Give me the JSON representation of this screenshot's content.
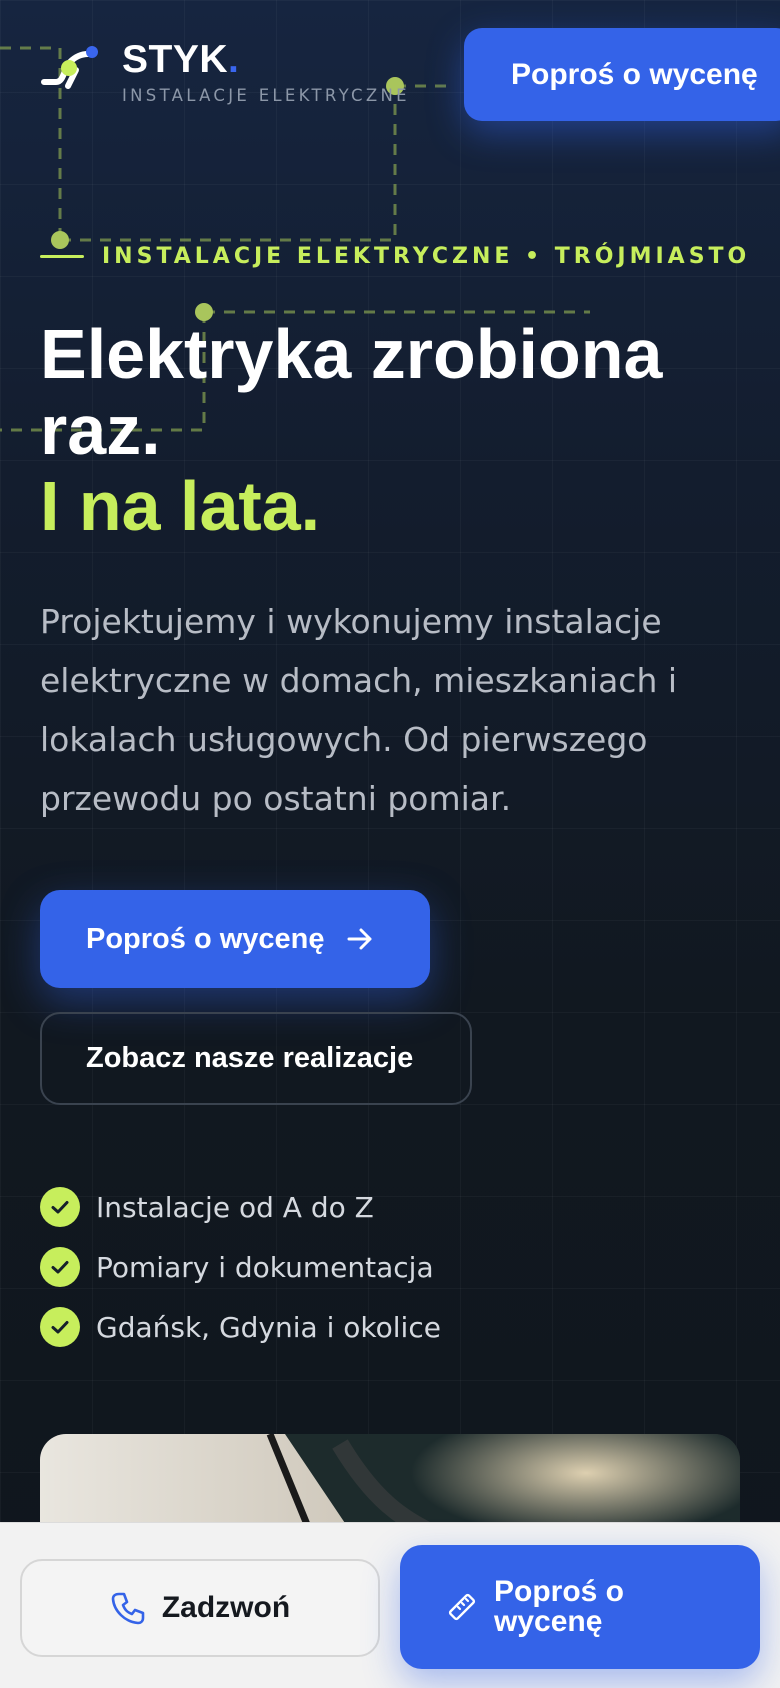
{
  "brand": {
    "name": "STYK",
    "name_dot": ".",
    "tagline": "INSTALACJE ELEKTRYCZNE",
    "logo_icon": "plug-logo-icon"
  },
  "header": {
    "cta_label": "Poproś o wycenę"
  },
  "hero": {
    "eyebrow": "INSTALACJE ELEKTRYCZNE • TRÓJMIASTO",
    "headline_white": "Elektryka zrobiona raz.",
    "headline_accent": "I na lata.",
    "lead": "Projektujemy i wykonujemy instalacje elektryczne w domach, mieszkaniach i lokalach usługowych. Od pierwszego przewodu po ostatni pomiar.",
    "primary_cta": "Poproś o wycenę",
    "primary_cta_icon": "arrow-right-icon",
    "secondary_cta": "Zobacz nasze realizacje",
    "features": [
      "Instalacje od A do Z",
      "Pomiary i dokumentacja",
      "Gdańsk, Gdynia i okolice"
    ],
    "feature_icon": "check-icon"
  },
  "bottom_bar": {
    "call_label": "Zadzwoń",
    "call_icon": "phone-icon",
    "quote_label": "Poproś o wycenę",
    "quote_icon": "ruler-icon"
  },
  "colors": {
    "background": "#121a24",
    "accent_lime": "#c7ee5c",
    "brand_blue": "#3463e8",
    "text_muted": "#b7bcc5"
  }
}
